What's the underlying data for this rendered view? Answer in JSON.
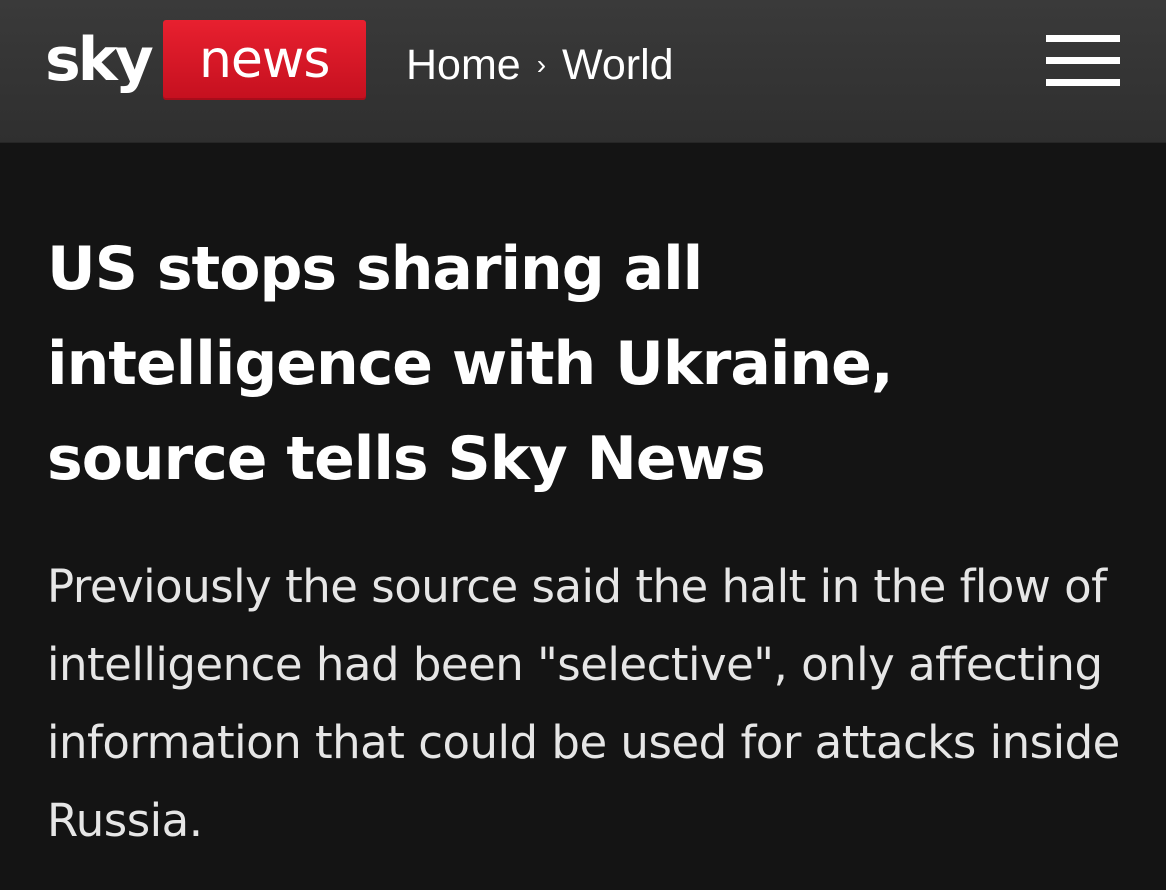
{
  "header": {
    "logo": {
      "sky": "sky",
      "news": "news",
      "news_color": "#d6192a"
    },
    "breadcrumb": {
      "home": "Home",
      "separator": "›",
      "section": "World"
    },
    "menu_icon": "hamburger-menu-icon"
  },
  "article": {
    "headline": "US stops sharing all intelligence with Ukraine, source tells Sky News",
    "standfirst": "Previously the source said the halt in the flow of intelligence had been \"selective\", only affecting information that could be used for attacks inside Russia."
  },
  "colors": {
    "background": "#141414",
    "header_background": "#333333",
    "text": "#ffffff"
  }
}
